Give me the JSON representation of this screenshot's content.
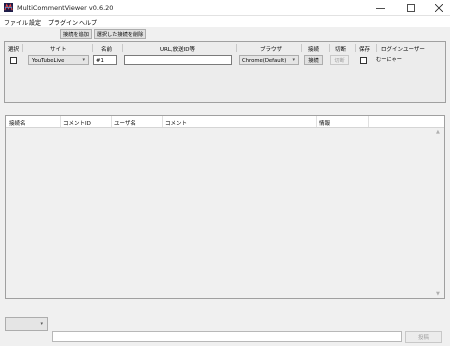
{
  "window": {
    "title": "MultiCommentViewer v0.6.20",
    "minimize_icon": "minimize-icon",
    "maximize_icon": "maximize-icon",
    "close_icon": "close-icon"
  },
  "menu": [
    "ファイル",
    "設定",
    "プラグイン",
    "ヘルプ"
  ],
  "toolbar": {
    "add_connection": "接続を追加",
    "remove_selected": "選択した接続を削除"
  },
  "connection_table": {
    "headers": [
      "選択",
      "サイト",
      "名前",
      "URL,放送ID等",
      "ブラウザ",
      "接続",
      "切断",
      "保存",
      "ログインユーザー"
    ],
    "row": {
      "selected": false,
      "site": "YouTubeLive",
      "name": "#1",
      "url": "",
      "browser": "Chrome(Default)",
      "connect_label": "接続",
      "disconnect_label": "切断",
      "save": false,
      "login_user": "むーにゃー"
    }
  },
  "comment_table": {
    "headers": [
      "接続名",
      "コメントID",
      "ユーザ名",
      "コメント",
      "情報"
    ]
  },
  "bottom": {
    "post_label": "投稿",
    "comment_value": ""
  },
  "colors": {
    "window_bg": "#f0f0f0",
    "titlebar_bg": "#ffffff",
    "button_bg": "#e1e1e1",
    "border": "#a0a0a0"
  }
}
